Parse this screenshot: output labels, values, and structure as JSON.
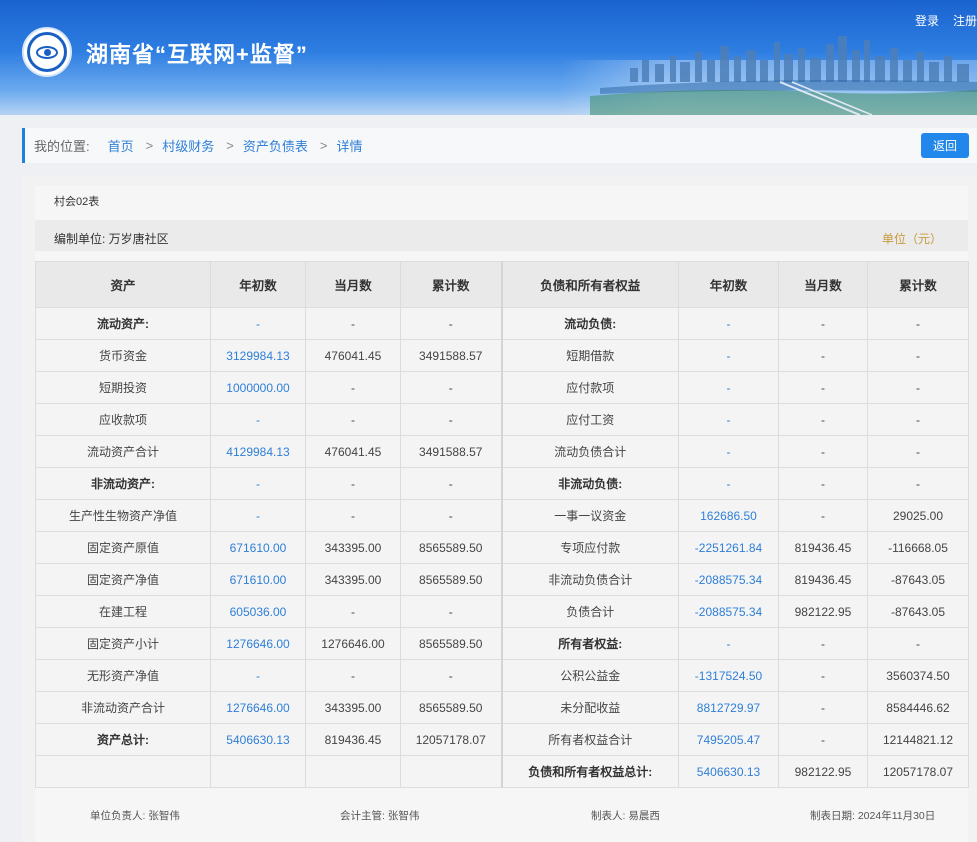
{
  "header": {
    "title": "湖南省“互联网+监督”",
    "login": "登录",
    "register": "注册"
  },
  "breadcrumb": {
    "prefix": "我的位置:",
    "items": [
      "首页",
      "村级财务",
      "资产负债表",
      "详情"
    ],
    "separator": ">",
    "back_button": "返回"
  },
  "report": {
    "form_no": "村会02表",
    "org": "编制单位: 万岁唐社区",
    "unit": "单位（元）",
    "headers": [
      "资产",
      "年初数",
      "当月数",
      "累计数",
      "负债和所有者权益",
      "年初数",
      "当月数",
      "累计数"
    ],
    "rows": [
      [
        "流动资产:",
        "-",
        "-",
        "-",
        "流动负债:",
        "-",
        "-",
        "-"
      ],
      [
        "货币资金",
        "3129984.13",
        "476041.45",
        "3491588.57",
        "短期借款",
        "-",
        "-",
        "-"
      ],
      [
        "短期投资",
        "1000000.00",
        "-",
        "-",
        "应付款项",
        "-",
        "-",
        "-"
      ],
      [
        "应收款项",
        "-",
        "-",
        "-",
        "应付工资",
        "-",
        "-",
        "-"
      ],
      [
        "流动资产合计",
        "4129984.13",
        "476041.45",
        "3491588.57",
        "流动负债合计",
        "-",
        "-",
        "-"
      ],
      [
        "非流动资产:",
        "-",
        "-",
        "-",
        "非流动负债:",
        "-",
        "-",
        "-"
      ],
      [
        "生产性生物资产净值",
        "-",
        "-",
        "-",
        "一事一议资金",
        "162686.50",
        "-",
        "29025.00"
      ],
      [
        "固定资产原值",
        "671610.00",
        "343395.00",
        "8565589.50",
        "专项应付款",
        "-2251261.84",
        "819436.45",
        "-116668.05"
      ],
      [
        "固定资产净值",
        "671610.00",
        "343395.00",
        "8565589.50",
        "非流动负债合计",
        "-2088575.34",
        "819436.45",
        "-87643.05"
      ],
      [
        "在建工程",
        "605036.00",
        "-",
        "-",
        "负债合计",
        "-2088575.34",
        "982122.95",
        "-87643.05"
      ],
      [
        "固定资产小计",
        "1276646.00",
        "1276646.00",
        "8565589.50",
        "所有者权益:",
        "-",
        "-",
        "-"
      ],
      [
        "无形资产净值",
        "-",
        "-",
        "-",
        "公积公益金",
        "-1317524.50",
        "-",
        "3560374.50"
      ],
      [
        "非流动资产合计",
        "1276646.00",
        "343395.00",
        "8565589.50",
        "未分配收益",
        "8812729.97",
        "-",
        "8584446.62"
      ],
      [
        "资产总计:",
        "5406630.13",
        "819436.45",
        "12057178.07",
        "所有者权益合计",
        "7495205.47",
        "-",
        "12144821.12"
      ],
      [
        "",
        "",
        "",
        "",
        "负债和所有者权益总计:",
        "5406630.13",
        "982122.95",
        "12057178.07"
      ]
    ],
    "bold_rows_left": [
      0,
      5,
      13
    ],
    "bold_rows_right": [
      0,
      5,
      10,
      14
    ]
  },
  "signatures": {
    "leader": "单位负责人: 张智伟",
    "accountant": "会计主管: 张智伟",
    "preparer": "制表人: 易晨西",
    "date": "制表日期: 2024年11月30日"
  }
}
